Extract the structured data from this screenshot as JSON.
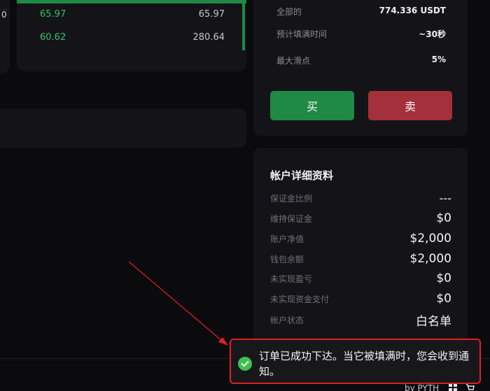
{
  "left_stub": {
    "value": "0"
  },
  "orderbook": {
    "rows": [
      {
        "price": "65.97",
        "size": "65.97"
      },
      {
        "price": "60.62",
        "size": "280.64"
      }
    ],
    "accent_color": "#1f8a43"
  },
  "trade": {
    "rows": [
      {
        "label": "全部的",
        "value": "774.336 USDT"
      },
      {
        "label": "预计填满时间",
        "value": "~30秒"
      },
      {
        "label": "最大滑点",
        "value": "5%"
      }
    ],
    "buy_label": "买",
    "sell_label": "卖",
    "buy_color": "#1f8a43",
    "sell_color": "#a3303a"
  },
  "account": {
    "title": "帐户详细资料",
    "rows": [
      {
        "label": "保证金比例",
        "value": "---"
      },
      {
        "label": "维持保证金",
        "value": "$0"
      },
      {
        "label": "账户净值",
        "value": "$2,000"
      },
      {
        "label": "钱包余额",
        "value": "$2,000"
      },
      {
        "label": "未实现盈亏",
        "value": "$0"
      },
      {
        "label": "未实现资金支付",
        "value": "$0"
      },
      {
        "label": "帐户状态",
        "value": "白名单"
      }
    ]
  },
  "footer": {
    "text": "by PYTH",
    "icons": [
      "grid-icon",
      "cart-icon"
    ]
  },
  "toast": {
    "message": "订单已成功下达。当它被填满时，您会收到通知。",
    "icon": "check-circle-icon",
    "highlight_color": "#e02020"
  }
}
